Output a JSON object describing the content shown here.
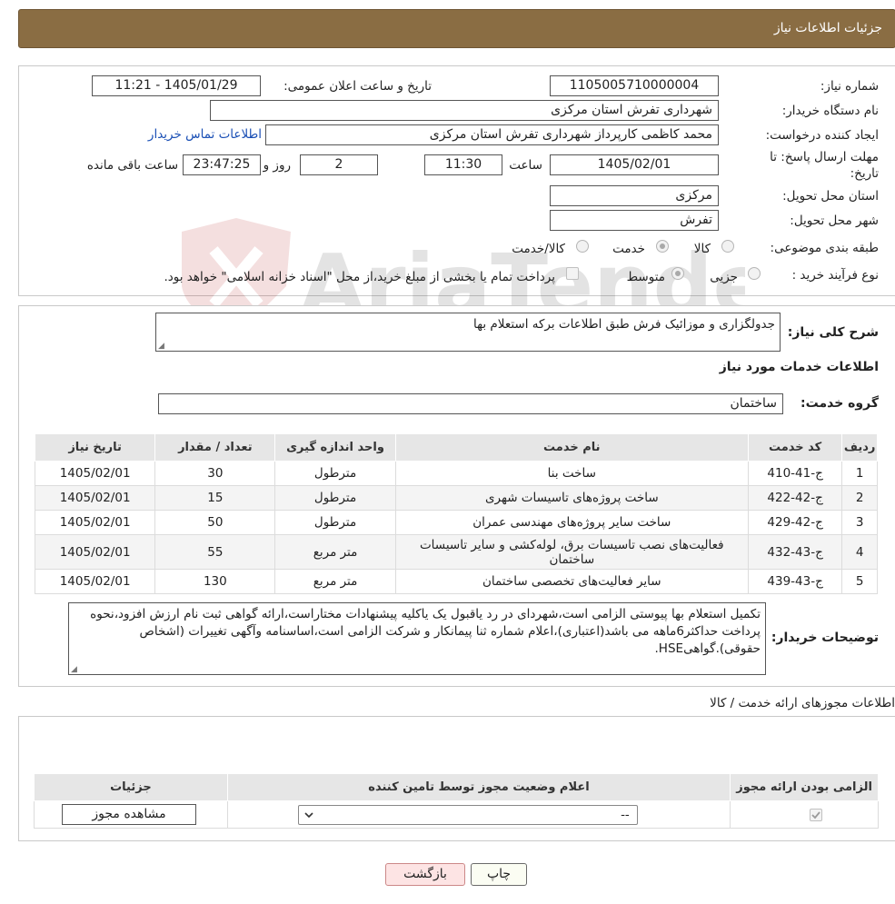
{
  "header": {
    "title": "جزئیات اطلاعات نیاز"
  },
  "info": {
    "need_number_label": "شماره نیاز:",
    "need_number": "1105005710000004",
    "announce_label": "تاریخ و ساعت اعلان عمومی:",
    "announce_value": "1405/01/29 - 11:21",
    "buyer_org_label": "نام دستگاه خریدار:",
    "buyer_org": "شهرداری تفرش استان مرکزی",
    "creator_label": "ایجاد کننده درخواست:",
    "creator": "محمد کاظمی کارپرداز شهرداری تفرش استان مرکزی",
    "contact_link": "اطلاعات تماس خریدار",
    "deadline_label_1": "مهلت ارسال پاسخ: تا",
    "deadline_label_2": "تاریخ:",
    "deadline_date": "1405/02/01",
    "time_label": "ساعت",
    "deadline_time": "11:30",
    "days_value": "2",
    "days_label": "روز و",
    "remaining_time": "23:47:25",
    "remaining_label": "ساعت باقی مانده",
    "province_label": "استان محل تحویل:",
    "province": "مرکزی",
    "city_label": "شهر محل تحویل:",
    "city": "تفرش",
    "category_label": "طبقه بندی موضوعی:",
    "category_options": [
      "کالا",
      "خدمت",
      "کالا/خدمت"
    ],
    "category_selected": "خدمت",
    "process_label": "نوع فرآیند خرید :",
    "process_options": [
      "جزیی",
      "متوسط"
    ],
    "process_selected": "متوسط",
    "payment_note": "پرداخت تمام یا بخشی از مبلغ خرید،از محل \"اسناد خزانه اسلامی\" خواهد بود."
  },
  "watermark": "AriaTender.net",
  "need_desc": {
    "label": "شرح کلی نیاز:",
    "value": "جدولگزاری و موزائیک فرش طبق اطلاعات برکه استعلام بها"
  },
  "services": {
    "section_title": "اطلاعات خدمات مورد نیاز",
    "group_label": "گروه خدمت:",
    "group_value": "ساختمان",
    "columns": [
      "ردیف",
      "کد خدمت",
      "نام خدمت",
      "واحد اندازه گیری",
      "تعداد / مقدار",
      "تاریخ نیاز"
    ],
    "rows": [
      {
        "row": "1",
        "code": "ج-41-410",
        "name": "ساخت بنا",
        "unit": "مترطول",
        "qty": "30",
        "date": "1405/02/01"
      },
      {
        "row": "2",
        "code": "ج-42-422",
        "name": "ساخت پروژه‌های تاسیسات شهری",
        "unit": "مترطول",
        "qty": "15",
        "date": "1405/02/01"
      },
      {
        "row": "3",
        "code": "ج-42-429",
        "name": "ساخت سایر پروژه‌های مهندسی عمران",
        "unit": "مترطول",
        "qty": "50",
        "date": "1405/02/01"
      },
      {
        "row": "4",
        "code": "ج-43-432",
        "name": "فعالیت‌های نصب تاسیسات برق، لوله‌کشی و سایر تاسیسات ساختمان",
        "unit": "متر مربع",
        "qty": "55",
        "date": "1405/02/01"
      },
      {
        "row": "5",
        "code": "ج-43-439",
        "name": "سایر فعالیت‌های تخصصی ساختمان",
        "unit": "متر مربع",
        "qty": "130",
        "date": "1405/02/01"
      }
    ]
  },
  "buyer_notes": {
    "label": "توضیحات خریدار:",
    "value": "تکمیل استعلام بها پیوستی الزامی است،شهردای در رد یاقبول یک یاکلیه پیشنهادات مختاراست،ارائه گواهی ثبت نام ارزش افزود،نحوه پرداخت حداکثر6ماهه می باشد(اعتباری)،اعلام شماره ثنا پیمانکار و شرکت الزامی است،اساسنامه وآگهی تغییرات (اشخاص حقوقی).گواهیHSE."
  },
  "permits": {
    "section_title": "اطلاعات مجوزهای ارائه خدمت / کالا",
    "columns": [
      "الزامی بودن ارائه مجوز",
      "اعلام وضعیت مجوز توسط تامین کننده",
      "جزئیات"
    ],
    "select_value": "--",
    "view_button": "مشاهده مجوز"
  },
  "buttons": {
    "print": "چاپ",
    "back": "بازگشت"
  }
}
